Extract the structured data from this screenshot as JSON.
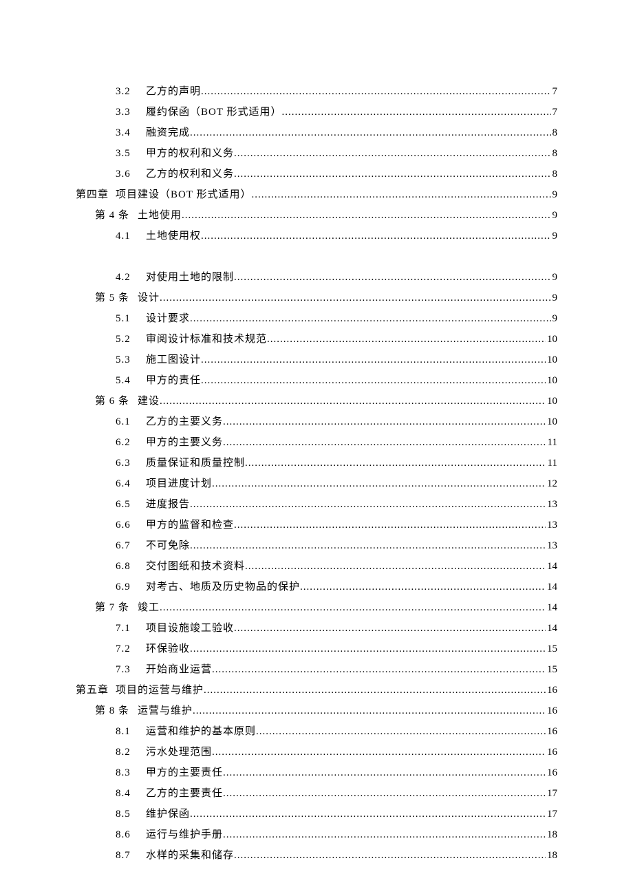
{
  "toc": [
    {
      "level": 2,
      "num": "3.2",
      "title": "乙方的声明",
      "page": "7",
      "gap_after": false
    },
    {
      "level": 2,
      "num": "3.3",
      "title": "履约保函（BOT 形式适用）",
      "page": "7",
      "gap_after": false
    },
    {
      "level": 2,
      "num": "3.4",
      "title": "融资完成",
      "page": "8",
      "gap_after": false
    },
    {
      "level": 2,
      "num": "3.5",
      "title": "甲方的权利和义务",
      "page": "8",
      "gap_after": false
    },
    {
      "level": 2,
      "num": "3.6",
      "title": "乙方的权利和义务",
      "page": "8",
      "gap_after": false
    },
    {
      "level": 0,
      "num": "第四章",
      "title": "项目建设（BOT 形式适用）",
      "page": "9",
      "gap_after": false
    },
    {
      "level": 1,
      "num": "第 4 条",
      "title": "土地使用",
      "page": "9",
      "gap_after": false
    },
    {
      "level": 2,
      "num": "4.1",
      "title": "土地使用权",
      "page": "9",
      "gap_after": true
    },
    {
      "level": 2,
      "num": "4.2",
      "title": "对使用土地的限制",
      "page": "9",
      "gap_after": false
    },
    {
      "level": 1,
      "num": "第 5 条",
      "title": "设计",
      "page": "9",
      "gap_after": false
    },
    {
      "level": 2,
      "num": "5.1",
      "title": "设计要求",
      "page": "9",
      "gap_after": false
    },
    {
      "level": 2,
      "num": "5.2",
      "title": "审阅设计标准和技术规范",
      "page": "10",
      "gap_after": false
    },
    {
      "level": 2,
      "num": "5.3",
      "title": "施工图设计",
      "page": "10",
      "gap_after": false
    },
    {
      "level": 2,
      "num": "5.4",
      "title": "甲方的责任",
      "page": "10",
      "gap_after": false
    },
    {
      "level": 1,
      "num": "第 6 条",
      "title": "建设",
      "page": "10",
      "gap_after": false
    },
    {
      "level": 2,
      "num": "6.1",
      "title": "乙方的主要义务",
      "page": "10",
      "gap_after": false
    },
    {
      "level": 2,
      "num": "6.2",
      "title": "甲方的主要义务",
      "page": "11",
      "gap_after": false
    },
    {
      "level": 2,
      "num": "6.3",
      "title": "质量保证和质量控制",
      "page": "11",
      "gap_after": false
    },
    {
      "level": 2,
      "num": "6.4",
      "title": "项目进度计划",
      "page": "12",
      "gap_after": false
    },
    {
      "level": 2,
      "num": "6.5",
      "title": "进度报告",
      "page": "13",
      "gap_after": false
    },
    {
      "level": 2,
      "num": "6.6",
      "title": "甲方的监督和检查",
      "page": "13",
      "gap_after": false
    },
    {
      "level": 2,
      "num": "6.7",
      "title": "不可免除",
      "page": "13",
      "gap_after": false
    },
    {
      "level": 2,
      "num": "6.8",
      "title": "交付图纸和技术资料",
      "page": "14",
      "gap_after": false
    },
    {
      "level": 2,
      "num": "6.9",
      "title": "对考古、地质及历史物品的保护",
      "page": "14",
      "gap_after": false
    },
    {
      "level": 1,
      "num": "第 7 条",
      "title": "竣工",
      "page": "14",
      "gap_after": false
    },
    {
      "level": 2,
      "num": "7.1",
      "title": "项目设施竣工验收",
      "page": "14",
      "gap_after": false
    },
    {
      "level": 2,
      "num": "7.2",
      "title": "环保验收",
      "page": "15",
      "gap_after": false
    },
    {
      "level": 2,
      "num": "7.3",
      "title": "开始商业运营",
      "page": "15",
      "gap_after": false
    },
    {
      "level": 0,
      "num": "第五章",
      "title": "项目的运营与维护",
      "page": "16",
      "gap_after": false
    },
    {
      "level": 1,
      "num": "第 8 条",
      "title": "运营与维护",
      "page": "16",
      "gap_after": false
    },
    {
      "level": 2,
      "num": "8.1",
      "title": "运营和维护的基本原则",
      "page": "16",
      "gap_after": false
    },
    {
      "level": 2,
      "num": "8.2",
      "title": "污水处理范围",
      "page": "16",
      "gap_after": false
    },
    {
      "level": 2,
      "num": "8.3",
      "title": "甲方的主要责任",
      "page": "16",
      "gap_after": false
    },
    {
      "level": 2,
      "num": "8.4",
      "title": "乙方的主要责任",
      "page": "17",
      "gap_after": false
    },
    {
      "level": 2,
      "num": "8.5",
      "title": "维护保函",
      "page": "17",
      "gap_after": false
    },
    {
      "level": 2,
      "num": "8.6",
      "title": "运行与维护手册",
      "page": "18",
      "gap_after": false
    },
    {
      "level": 2,
      "num": "8.7",
      "title": "水样的采集和储存",
      "page": "18",
      "gap_after": false
    }
  ]
}
